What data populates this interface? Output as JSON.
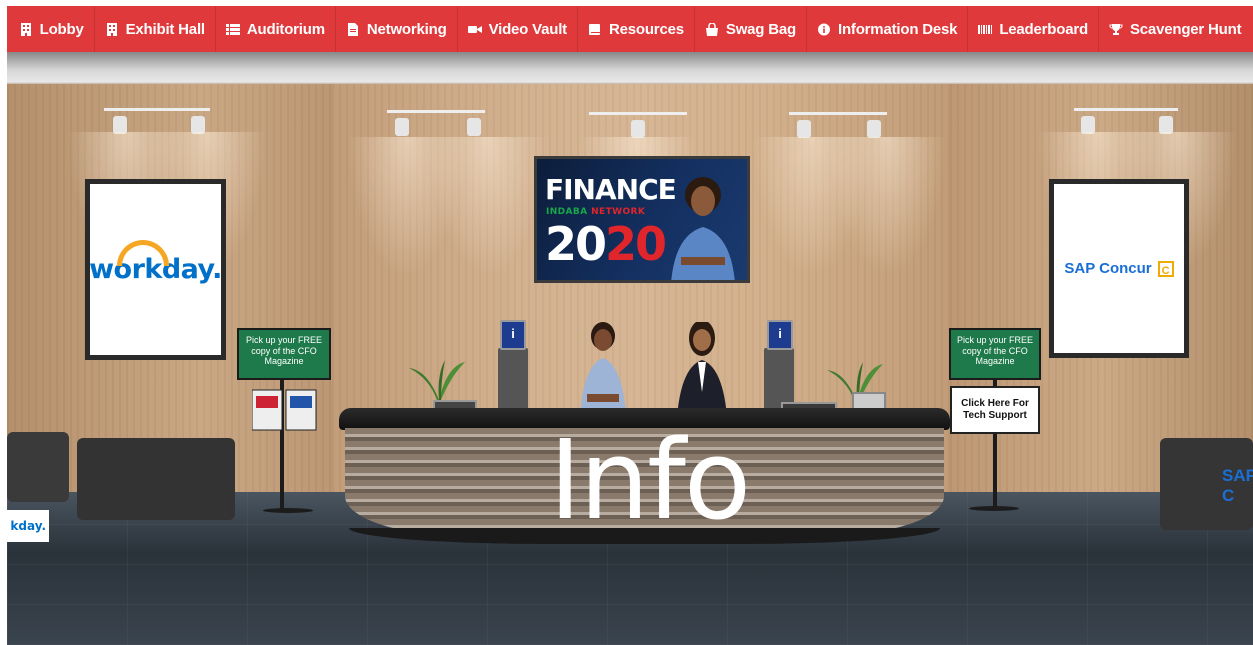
{
  "nav": {
    "items": [
      {
        "label": "Lobby",
        "icon": "building-icon"
      },
      {
        "label": "Exhibit Hall",
        "icon": "building-icon"
      },
      {
        "label": "Auditorium",
        "icon": "list-icon"
      },
      {
        "label": "Networking",
        "icon": "document-icon"
      },
      {
        "label": "Video Vault",
        "icon": "video-camera-icon"
      },
      {
        "label": "Resources",
        "icon": "book-icon"
      },
      {
        "label": "Swag Bag",
        "icon": "shopping-bag-icon"
      },
      {
        "label": "Information Desk",
        "icon": "info-circle-icon"
      },
      {
        "label": "Leaderboard",
        "icon": "barcode-icon"
      },
      {
        "label": "Scavenger Hunt",
        "icon": "trophy-icon"
      }
    ],
    "background_color": "#e0393c",
    "text_color": "#ffffff"
  },
  "scene": {
    "left_poster": {
      "brand": "workday."
    },
    "right_poster": {
      "brand": "SAP Concur",
      "mark": "C"
    },
    "tv": {
      "line1": "FINANCE",
      "line2a": "INDABA",
      "line2b": "NETWORK",
      "year_a": "20",
      "year_b": "20"
    },
    "left_sign": {
      "text": "Pick up your FREE copy of the CFO Magazine"
    },
    "right_sign": {
      "text": "Pick up your FREE copy of the CFO Magazine"
    },
    "tech_support": {
      "label": "Click Here For Tech Support"
    },
    "desk_label": "Info",
    "kiosk_badge": "i",
    "edge_left_logo": "kday.",
    "edge_right_logo": "SAP C"
  }
}
